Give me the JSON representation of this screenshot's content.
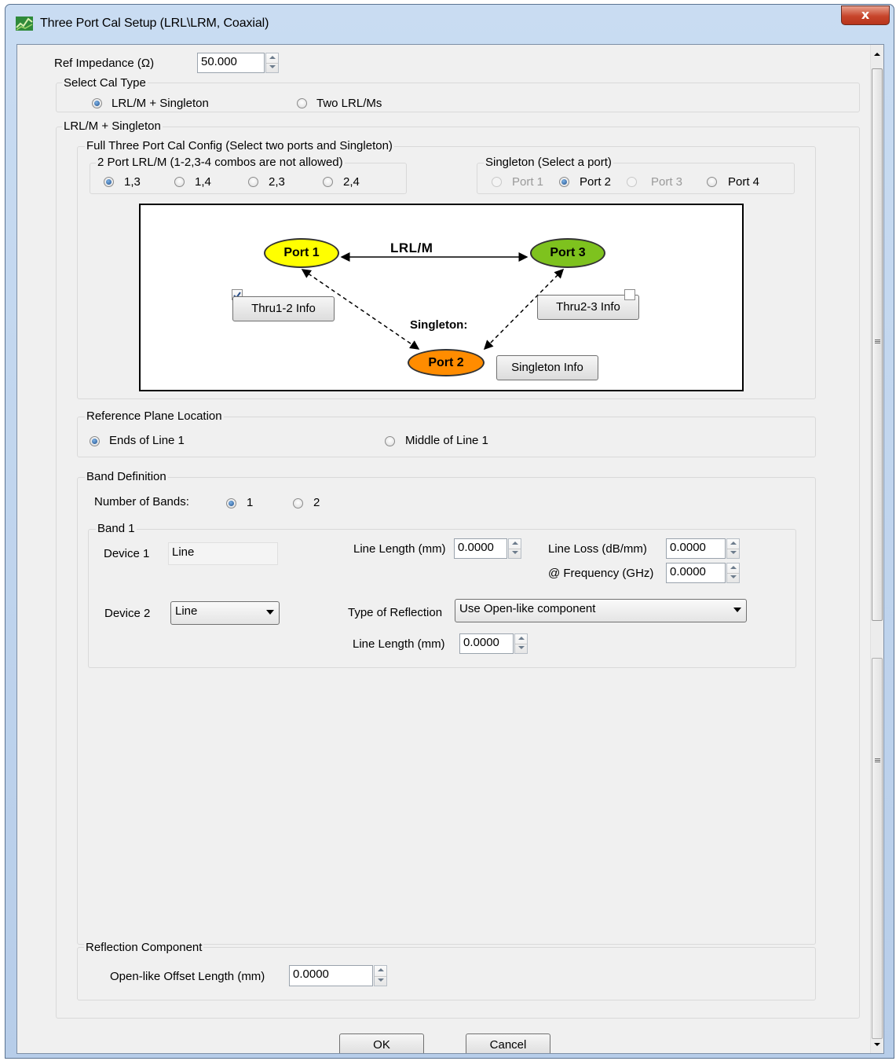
{
  "window": {
    "title": "Three Port Cal Setup (LRL\\LRM, Coaxial)",
    "close_label": "x"
  },
  "ref_impedance": {
    "label": "Ref Impedance (Ω)",
    "value": "50.000"
  },
  "cal_type": {
    "title": "Select Cal Type",
    "options": [
      "LRL/M + Singleton",
      "Two LRL/Ms"
    ],
    "selected": "LRL/M + Singleton"
  },
  "lrlm_singleton": {
    "title": "LRL/M + Singleton",
    "config_title": "Full Three Port Cal Config (Select two ports and Singleton)",
    "two_port": {
      "title": "2 Port LRL/M (1-2,3-4 combos are not allowed)",
      "options": [
        "1,3",
        "1,4",
        "2,3",
        "2,4"
      ],
      "selected": "1,3"
    },
    "singleton": {
      "title": "Singleton (Select a port)",
      "options": [
        "Port 1",
        "Port 2",
        "Port 3",
        "Port 4"
      ],
      "selected": "Port 2"
    },
    "diagram": {
      "port1": "Port 1",
      "port2": "Port 2",
      "port3": "Port 3",
      "lrlm_label": "LRL/M",
      "singleton_label": "Singleton:",
      "thru12_button": "Thru1-2 Info",
      "thru23_button": "Thru2-3 Info",
      "singleton_button": "Singleton Info",
      "thru12_checked": true,
      "thru23_checked": false,
      "port1_color": "#ffff00",
      "port2_color": "#ff8c00",
      "port3_color": "#7ec21e"
    }
  },
  "ref_plane": {
    "title": "Reference Plane Location",
    "options": [
      "Ends of Line 1",
      "Middle of Line 1"
    ],
    "selected": "Ends of Line 1"
  },
  "band_definition": {
    "title": "Band Definition",
    "num_bands_label": "Number of Bands:",
    "num_bands_options": [
      "1",
      "2"
    ],
    "num_bands_selected": "1",
    "band1": {
      "title": "Band 1",
      "device1_label": "Device 1",
      "device1_value": "Line",
      "line_length_label": "Line Length (mm)",
      "line_length_value": "0.0000",
      "line_loss_label": "Line Loss (dB/mm)",
      "line_loss_value": "0.0000",
      "frequency_label": "@ Frequency (GHz)",
      "frequency_value": "0.0000",
      "device2_label": "Device 2",
      "device2_value": "Line",
      "reflection_type_label": "Type of Reflection",
      "reflection_type_value": "Use Open-like component",
      "line_length2_label": "Line Length (mm)",
      "line_length2_value": "0.0000"
    }
  },
  "reflection_component": {
    "title": "Reflection Component",
    "offset_label": "Open-like Offset Length (mm)",
    "offset_value": "0.0000"
  },
  "buttons": {
    "ok": "OK",
    "cancel": "Cancel"
  }
}
